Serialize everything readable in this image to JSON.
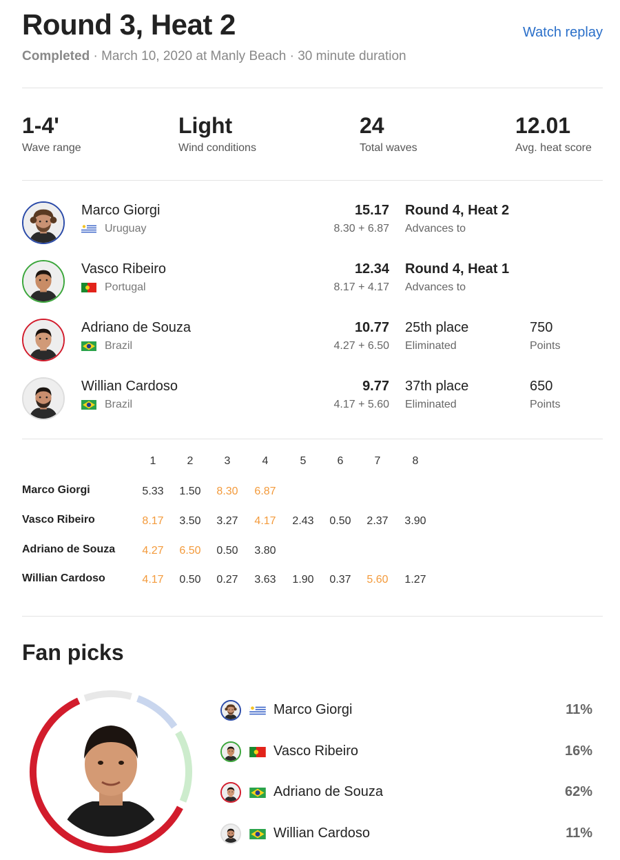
{
  "header": {
    "title": "Round 3, Heat 2",
    "watch_replay": "Watch replay",
    "status": "Completed",
    "details": " · March 10, 2020 at Manly Beach · 30 minute duration"
  },
  "stats": [
    {
      "value": "1-4'",
      "label": "Wave range"
    },
    {
      "value": "Light",
      "label": "Wind conditions"
    },
    {
      "value": "24",
      "label": "Total waves"
    },
    {
      "value": "12.01",
      "label": "Avg. heat score"
    }
  ],
  "surfers": [
    {
      "name": "Marco Giorgi",
      "country": "Uruguay",
      "total": "15.17",
      "breakdown": "8.30 + 6.87",
      "result": "Round 4, Heat 2",
      "result_sub": "Advances to",
      "points": "",
      "points_sub": "",
      "ring_color": "#2a4aa8"
    },
    {
      "name": "Vasco Ribeiro",
      "country": "Portugal",
      "total": "12.34",
      "breakdown": "8.17 + 4.17",
      "result": "Round 4, Heat 1",
      "result_sub": "Advances to",
      "points": "",
      "points_sub": "",
      "ring_color": "#3aa63a"
    },
    {
      "name": "Adriano de Souza",
      "country": "Brazil",
      "total": "10.77",
      "breakdown": "4.27 + 6.50",
      "result": "25th place",
      "result_sub": "Eliminated",
      "points": "750",
      "points_sub": "Points",
      "ring_color": "#d21c2c"
    },
    {
      "name": "Willian Cardoso",
      "country": "Brazil",
      "total": "9.77",
      "breakdown": "4.17 + 5.60",
      "result": "37th place",
      "result_sub": "Eliminated",
      "points": "650",
      "points_sub": "Points",
      "ring_color": "#dddddd"
    }
  ],
  "waves": {
    "columns": [
      "1",
      "2",
      "3",
      "4",
      "5",
      "6",
      "7",
      "8"
    ],
    "rows": [
      {
        "name": "Marco Giorgi",
        "scores": [
          "5.33",
          "1.50",
          "8.30",
          "6.87"
        ],
        "highlight": [
          2,
          3
        ]
      },
      {
        "name": "Vasco Ribeiro",
        "scores": [
          "8.17",
          "3.50",
          "3.27",
          "4.17",
          "2.43",
          "0.50",
          "2.37",
          "3.90"
        ],
        "highlight": [
          0,
          3
        ]
      },
      {
        "name": "Adriano de Souza",
        "scores": [
          "4.27",
          "6.50",
          "0.50",
          "3.80"
        ],
        "highlight": [
          0,
          1
        ]
      },
      {
        "name": "Willian Cardoso",
        "scores": [
          "4.17",
          "0.50",
          "0.27",
          "3.63",
          "1.90",
          "0.37",
          "5.60",
          "1.27"
        ],
        "highlight": [
          0,
          6
        ]
      }
    ],
    "highlight_color": "#f39a3b"
  },
  "fan_picks": {
    "title": "Fan picks",
    "picks": [
      {
        "name": "Marco Giorgi",
        "country": "Uruguay",
        "percent": "11%",
        "value": 11,
        "color": "#c9d6ee"
      },
      {
        "name": "Vasco Ribeiro",
        "country": "Portugal",
        "percent": "16%",
        "value": 16,
        "color": "#cdeccd"
      },
      {
        "name": "Adriano de Souza",
        "country": "Brazil",
        "percent": "62%",
        "value": 62,
        "color": "#d21c2c"
      },
      {
        "name": "Willian Cardoso",
        "country": "Brazil",
        "percent": "11%",
        "value": 11,
        "color": "#e8e8e8"
      }
    ]
  }
}
